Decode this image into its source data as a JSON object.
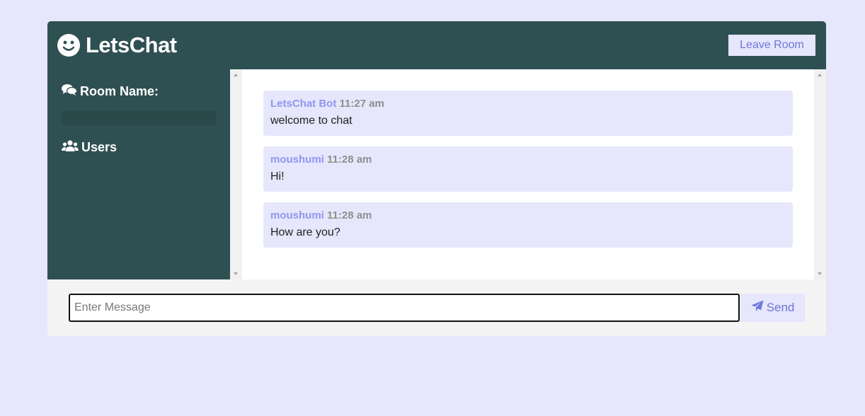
{
  "header": {
    "title": "LetsChat",
    "leave_label": "Leave Room"
  },
  "sidebar": {
    "room_label": "Room Name:",
    "room_value": "",
    "users_label": "Users"
  },
  "messages": [
    {
      "user": "LetsChat Bot",
      "time": "11:27 am",
      "text": "welcome to chat"
    },
    {
      "user": "moushumi",
      "time": "11:28 am",
      "text": "Hi!"
    },
    {
      "user": "moushumi",
      "time": "11:28 am",
      "text": "How are you?"
    }
  ],
  "composer": {
    "placeholder": "Enter Message",
    "value": "",
    "send_label": "Send"
  },
  "colors": {
    "background": "#e6e6fc",
    "header": "#2f5052",
    "accent": "#6f78d9",
    "username": "#8f97ee"
  }
}
